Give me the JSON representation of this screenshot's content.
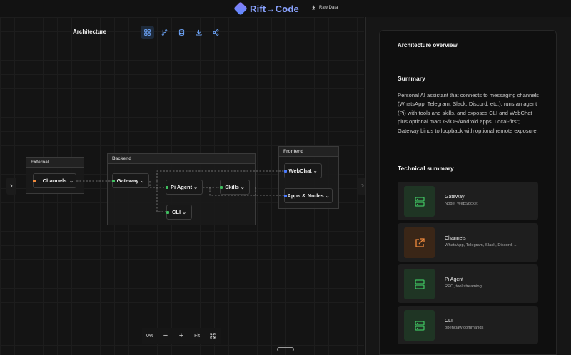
{
  "app": {
    "brand": "Rift→Code",
    "raw_data_label": "Raw Data"
  },
  "canvas": {
    "title": "Architecture",
    "toolbar": [
      {
        "name": "grid-layout",
        "icon": "grid-icon",
        "active": true
      },
      {
        "name": "git-branch",
        "icon": "branch-icon",
        "active": false
      },
      {
        "name": "database",
        "icon": "database-icon",
        "active": false
      },
      {
        "name": "download",
        "icon": "download-icon",
        "active": false
      },
      {
        "name": "share",
        "icon": "share-icon",
        "active": false
      }
    ]
  },
  "groups": {
    "external": {
      "label": "External"
    },
    "backend": {
      "label": "Backend"
    },
    "frontend": {
      "label": "Frontend"
    }
  },
  "nodes": {
    "channels": {
      "label": "Channels"
    },
    "gateway": {
      "label": "Gateway"
    },
    "pi_agent": {
      "label": "Pi Agent"
    },
    "skills": {
      "label": "Skills"
    },
    "cli": {
      "label": "CLI"
    },
    "webchat": {
      "label": "WebChat"
    },
    "apps_nodes": {
      "label": "Apps & Nodes"
    }
  },
  "zoom": {
    "level": "0%",
    "minus": "−",
    "plus": "+",
    "fit": "Fit"
  },
  "panel": {
    "title": "Architecture overview",
    "summary_heading": "Summary",
    "summary_text": "Personal AI assistant that connects to messaging channels (WhatsApp, Telegram, Slack, Discord, etc.), runs an agent (Pi) with tools and skills, and exposes CLI and WebChat plus optional macOS/iOS/Android apps. Local-first; Gateway binds to loopback with optional remote exposure.",
    "tech_heading": "Technical summary",
    "cards": [
      {
        "name": "Gateway",
        "detail": "Node, WebSocket",
        "icon": "server-icon",
        "color": "#3fbf5f"
      },
      {
        "name": "Channels",
        "detail": "WhatsApp, Telegram, Slack, Discord, ...",
        "icon": "external-link-icon",
        "color": "#f08a3c"
      },
      {
        "name": "Pi Agent",
        "detail": "RPC, tool streaming",
        "icon": "server-icon",
        "color": "#3fbf5f"
      },
      {
        "name": "CLI",
        "detail": "openclaw commands",
        "icon": "server-icon",
        "color": "#3fbf5f"
      }
    ]
  },
  "colors": {
    "accent": "#8aa3ff",
    "green": "#3fbf5f",
    "orange": "#f08a3c",
    "blue_port": "#4b7bff"
  }
}
